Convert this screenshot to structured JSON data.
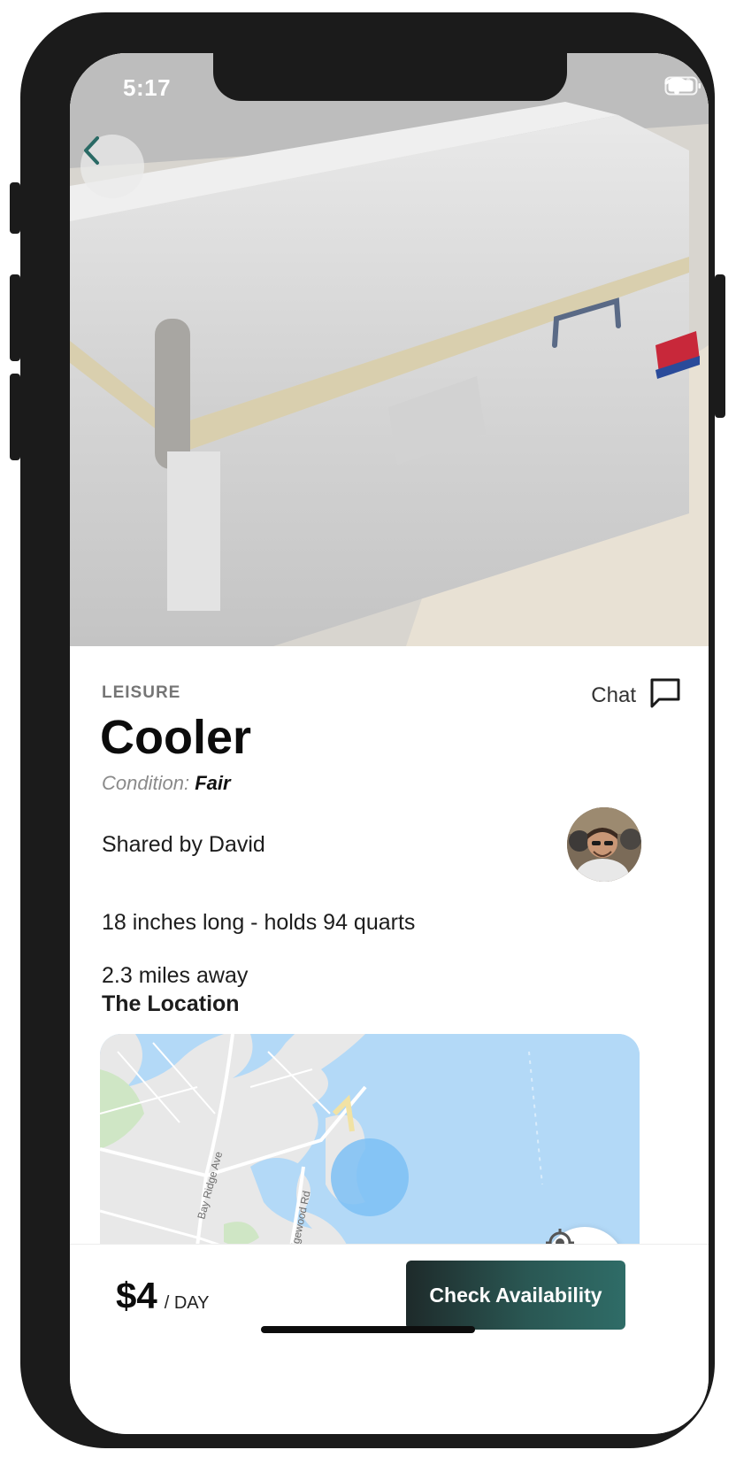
{
  "status_bar": {
    "time": "5:17"
  },
  "item": {
    "category": "LEISURE",
    "title": "Cooler",
    "condition_label": "Condition:",
    "condition_value": "Fair",
    "shared_prefix": "Shared by",
    "owner_name": "David",
    "description": "18 inches long - holds 94 quarts",
    "distance_value": "2.3",
    "distance_suffix": "miles away",
    "location_title": "The Location"
  },
  "chat": {
    "label": "Chat"
  },
  "map": {
    "labels": [
      "Bay Ridge Ave",
      "Edgewood Rd"
    ]
  },
  "pricing": {
    "amount": "$4",
    "unit": "/ DAY"
  },
  "cta": {
    "label": "Check Availability"
  },
  "colors": {
    "accent": "#2a6a65",
    "map_water": "#b3d9f7",
    "location_circle": "#7cc0f5"
  },
  "icons": {
    "back": "chevron-left-icon",
    "chat": "chat-bubble-icon",
    "locate": "crosshair-icon",
    "wifi": "wifi-icon",
    "battery": "battery-icon"
  }
}
